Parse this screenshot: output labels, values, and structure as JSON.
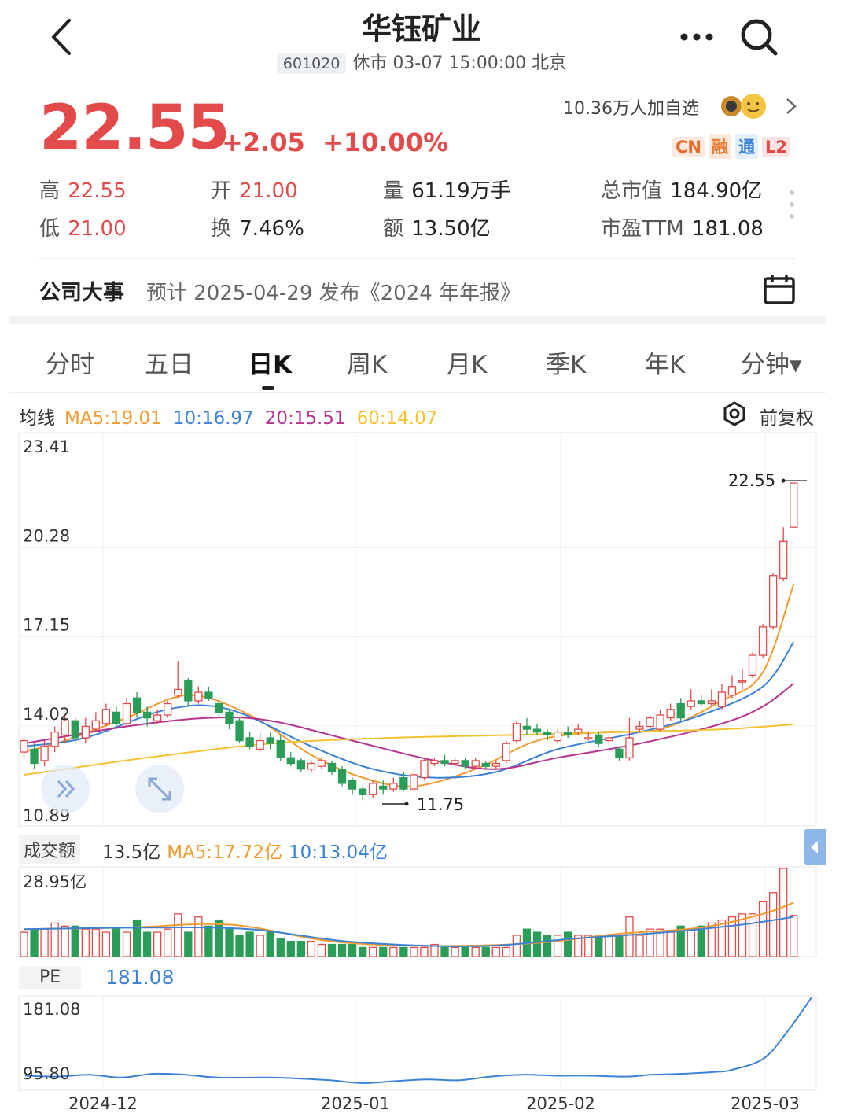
{
  "header": {
    "title": "华钰矿业",
    "code": "601020",
    "status": "休市 03-07 15:00:00 北京",
    "more_icon": "more-dots-icon",
    "search_icon": "search-icon",
    "back_icon": "back-arrow-icon"
  },
  "quote": {
    "price": "22.55",
    "change": "+2.05",
    "change_pct": "+10.00%",
    "followers": "10.36万人加自选",
    "badges": [
      "CN",
      "融",
      "通",
      "L2"
    ],
    "stats": [
      {
        "label": "高",
        "value": "22.55",
        "value_color": "#e34a4a"
      },
      {
        "label": "开",
        "value": "21.00",
        "value_color": "#e34a4a"
      },
      {
        "label": "量",
        "value": "61.19万手",
        "value_color": "#222"
      },
      {
        "label": "总市值",
        "value": "184.90亿",
        "value_color": "#222"
      },
      {
        "label": "低",
        "value": "21.00",
        "value_color": "#e34a4a"
      },
      {
        "label": "换",
        "value": "7.46%",
        "value_color": "#222"
      },
      {
        "label": "额",
        "value": "13.50亿",
        "value_color": "#222"
      },
      {
        "label": "市盈TTM",
        "value": "181.08",
        "value_color": "#222"
      }
    ]
  },
  "event": {
    "title": "公司大事",
    "text": "预计 2025-04-29 发布《2024 年年报》"
  },
  "tabs": [
    {
      "label": "分时",
      "active": false
    },
    {
      "label": "五日",
      "active": false
    },
    {
      "label": "日K",
      "active": true
    },
    {
      "label": "周K",
      "active": false
    },
    {
      "label": "月K",
      "active": false
    },
    {
      "label": "季K",
      "active": false
    },
    {
      "label": "年K",
      "active": false
    },
    {
      "label": "分钟▾",
      "active": false
    }
  ],
  "ma_legend": {
    "title": "均线",
    "items": [
      {
        "text": "MA5:19.01",
        "color": "#f29b2e"
      },
      {
        "text": "10:16.97",
        "color": "#3b82d6"
      },
      {
        "text": "20:15.51",
        "color": "#b8338f"
      },
      {
        "text": "60:14.07",
        "color": "#f2c230"
      }
    ],
    "adjust": "前复权"
  },
  "volume_legend": {
    "title": "成交额",
    "items": [
      {
        "text": "13.5亿",
        "color": "#333"
      },
      {
        "text": "MA5:17.72亿",
        "color": "#f29b2e"
      },
      {
        "text": "10:13.04亿",
        "color": "#3b82d6"
      }
    ]
  },
  "pe_legend": {
    "title": "PE",
    "value": "181.08",
    "value_color": "#3b82d6"
  },
  "colors": {
    "up": "#e34a4a",
    "down": "#2a9d59"
  },
  "chart_data": [
    {
      "type": "candlestick",
      "y_ticks": [
        "23.41",
        "20.28",
        "17.15",
        "14.02",
        "10.89"
      ],
      "ylim": [
        10.89,
        23.41
      ],
      "x_ticks": [
        "2024-12",
        "2025-01",
        "2025-02",
        "2025-03"
      ],
      "annotations": [
        {
          "text": "22.55",
          "kind": "max"
        },
        {
          "text": "11.75",
          "kind": "min"
        }
      ],
      "candles": [
        {
          "o": 13.1,
          "c": 13.5,
          "h": 13.7,
          "l": 12.9
        },
        {
          "o": 13.2,
          "c": 12.7,
          "h": 13.4,
          "l": 12.5
        },
        {
          "o": 12.8,
          "c": 13.3,
          "h": 13.5,
          "l": 12.6
        },
        {
          "o": 13.3,
          "c": 13.8,
          "h": 14.0,
          "l": 13.1
        },
        {
          "o": 13.7,
          "c": 14.2,
          "h": 14.4,
          "l": 13.4
        },
        {
          "o": 14.2,
          "c": 13.6,
          "h": 14.3,
          "l": 13.4
        },
        {
          "o": 13.6,
          "c": 14.0,
          "h": 14.3,
          "l": 13.4
        },
        {
          "o": 13.9,
          "c": 14.2,
          "h": 14.5,
          "l": 13.8
        },
        {
          "o": 14.1,
          "c": 14.6,
          "h": 14.8,
          "l": 14.0
        },
        {
          "o": 14.5,
          "c": 14.1,
          "h": 14.7,
          "l": 13.9
        },
        {
          "o": 14.1,
          "c": 14.8,
          "h": 15.0,
          "l": 14.0
        },
        {
          "o": 15.0,
          "c": 14.5,
          "h": 15.2,
          "l": 14.3
        },
        {
          "o": 14.5,
          "c": 14.3,
          "h": 14.7,
          "l": 14.0
        },
        {
          "o": 14.2,
          "c": 14.4,
          "h": 14.6,
          "l": 14.1
        },
        {
          "o": 14.4,
          "c": 14.8,
          "h": 14.9,
          "l": 14.3
        },
        {
          "o": 15.1,
          "c": 15.3,
          "h": 16.3,
          "l": 15.0
        },
        {
          "o": 15.6,
          "c": 14.9,
          "h": 15.7,
          "l": 14.7
        },
        {
          "o": 14.9,
          "c": 15.2,
          "h": 15.4,
          "l": 14.8
        },
        {
          "o": 15.2,
          "c": 15.0,
          "h": 15.4,
          "l": 14.9
        },
        {
          "o": 14.8,
          "c": 14.5,
          "h": 15.0,
          "l": 14.3
        },
        {
          "o": 14.5,
          "c": 14.1,
          "h": 14.6,
          "l": 13.9
        },
        {
          "o": 14.2,
          "c": 13.5,
          "h": 14.3,
          "l": 13.4
        },
        {
          "o": 13.6,
          "c": 13.3,
          "h": 13.8,
          "l": 13.2
        },
        {
          "o": 13.2,
          "c": 13.5,
          "h": 13.8,
          "l": 13.1
        },
        {
          "o": 13.6,
          "c": 13.4,
          "h": 13.8,
          "l": 13.2
        },
        {
          "o": 13.5,
          "c": 12.9,
          "h": 13.7,
          "l": 12.8
        },
        {
          "o": 12.9,
          "c": 12.7,
          "h": 13.1,
          "l": 12.6
        },
        {
          "o": 12.8,
          "c": 12.5,
          "h": 12.9,
          "l": 12.4
        },
        {
          "o": 12.5,
          "c": 12.7,
          "h": 12.8,
          "l": 12.4
        },
        {
          "o": 12.6,
          "c": 12.8,
          "h": 12.9,
          "l": 12.5
        },
        {
          "o": 12.7,
          "c": 12.4,
          "h": 12.8,
          "l": 12.3
        },
        {
          "o": 12.5,
          "c": 12.0,
          "h": 12.6,
          "l": 11.9
        },
        {
          "o": 12.1,
          "c": 11.8,
          "h": 12.2,
          "l": 11.6
        },
        {
          "o": 11.8,
          "c": 11.6,
          "h": 11.9,
          "l": 11.4
        },
        {
          "o": 11.6,
          "c": 12.0,
          "h": 12.1,
          "l": 11.5
        },
        {
          "o": 11.9,
          "c": 11.8,
          "h": 12.1,
          "l": 11.6
        },
        {
          "o": 11.8,
          "c": 12.0,
          "h": 12.2,
          "l": 11.7
        },
        {
          "o": 12.2,
          "c": 11.8,
          "h": 12.4,
          "l": 11.75
        },
        {
          "o": 11.8,
          "c": 12.3,
          "h": 12.4,
          "l": 11.75
        },
        {
          "o": 12.2,
          "c": 12.8,
          "h": 12.9,
          "l": 12.1
        },
        {
          "o": 12.7,
          "c": 12.8,
          "h": 12.9,
          "l": 12.6
        },
        {
          "o": 12.8,
          "c": 12.7,
          "h": 13.0,
          "l": 12.6
        },
        {
          "o": 12.7,
          "c": 12.8,
          "h": 12.9,
          "l": 12.6
        },
        {
          "o": 12.8,
          "c": 12.6,
          "h": 12.9,
          "l": 12.5
        },
        {
          "o": 12.6,
          "c": 12.8,
          "h": 12.9,
          "l": 12.5
        },
        {
          "o": 12.7,
          "c": 12.6,
          "h": 12.8,
          "l": 12.5
        },
        {
          "o": 12.6,
          "c": 12.7,
          "h": 12.8,
          "l": 12.5
        },
        {
          "o": 12.8,
          "c": 13.4,
          "h": 13.5,
          "l": 12.7
        },
        {
          "o": 13.5,
          "c": 14.1,
          "h": 14.2,
          "l": 13.4
        },
        {
          "o": 14.0,
          "c": 13.9,
          "h": 14.3,
          "l": 13.7
        },
        {
          "o": 13.9,
          "c": 13.8,
          "h": 14.1,
          "l": 13.7
        },
        {
          "o": 13.8,
          "c": 13.7,
          "h": 13.9,
          "l": 13.5
        },
        {
          "o": 13.5,
          "c": 13.8,
          "h": 13.9,
          "l": 13.4
        },
        {
          "o": 13.8,
          "c": 13.7,
          "h": 14.0,
          "l": 13.6
        },
        {
          "o": 13.8,
          "c": 13.9,
          "h": 14.1,
          "l": 13.7
        },
        {
          "o": 13.6,
          "c": 13.6,
          "h": 13.8,
          "l": 13.5
        },
        {
          "o": 13.7,
          "c": 13.4,
          "h": 13.8,
          "l": 13.3
        },
        {
          "o": 13.5,
          "c": 13.6,
          "h": 13.7,
          "l": 13.4
        },
        {
          "o": 13.2,
          "c": 12.9,
          "h": 13.3,
          "l": 12.8
        },
        {
          "o": 12.9,
          "c": 13.6,
          "h": 14.3,
          "l": 12.8
        },
        {
          "o": 13.9,
          "c": 14.0,
          "h": 14.2,
          "l": 13.8
        },
        {
          "o": 14.0,
          "c": 14.3,
          "h": 14.4,
          "l": 13.9
        },
        {
          "o": 13.9,
          "c": 14.4,
          "h": 14.6,
          "l": 13.8
        },
        {
          "o": 14.3,
          "c": 14.6,
          "h": 14.8,
          "l": 14.2
        },
        {
          "o": 14.8,
          "c": 14.3,
          "h": 15.0,
          "l": 14.2
        },
        {
          "o": 14.7,
          "c": 14.9,
          "h": 15.3,
          "l": 14.6
        },
        {
          "o": 14.9,
          "c": 14.8,
          "h": 15.1,
          "l": 14.7
        },
        {
          "o": 14.8,
          "c": 14.9,
          "h": 15.3,
          "l": 14.7
        },
        {
          "o": 14.7,
          "c": 15.2,
          "h": 15.5,
          "l": 14.6
        },
        {
          "o": 15.1,
          "c": 15.4,
          "h": 15.8,
          "l": 15.0
        },
        {
          "o": 15.6,
          "c": 15.6,
          "h": 16.0,
          "l": 15.3
        },
        {
          "o": 15.8,
          "c": 16.5,
          "h": 16.6,
          "l": 15.7
        },
        {
          "o": 16.5,
          "c": 17.5,
          "h": 17.6,
          "l": 16.4
        },
        {
          "o": 17.5,
          "c": 19.3,
          "h": 19.4,
          "l": 17.4
        },
        {
          "o": 19.2,
          "c": 20.5,
          "h": 21.0,
          "l": 19.1
        },
        {
          "o": 21.0,
          "c": 22.55,
          "h": 22.55,
          "l": 21.0
        }
      ],
      "ma_series": [
        {
          "name": "MA5",
          "color": "#f29b2e",
          "anchors": [
            [
              0,
              13.1
            ],
            [
              4,
              13.5
            ],
            [
              10,
              14.3
            ],
            [
              16,
              15.1
            ],
            [
              22,
              14.4
            ],
            [
              28,
              13.0
            ],
            [
              33,
              12.2
            ],
            [
              38,
              11.9
            ],
            [
              44,
              12.5
            ],
            [
              50,
              13.5
            ],
            [
              56,
              13.8
            ],
            [
              62,
              13.9
            ],
            [
              68,
              14.9
            ],
            [
              72,
              15.9
            ],
            [
              75,
              19.01
            ]
          ]
        },
        {
          "name": "10",
          "color": "#3b82d6",
          "anchors": [
            [
              0,
              13.3
            ],
            [
              6,
              13.6
            ],
            [
              14,
              14.6
            ],
            [
              20,
              14.6
            ],
            [
              28,
              13.3
            ],
            [
              34,
              12.5
            ],
            [
              40,
              12.2
            ],
            [
              46,
              12.4
            ],
            [
              52,
              13.2
            ],
            [
              60,
              13.8
            ],
            [
              66,
              14.4
            ],
            [
              72,
              15.4
            ],
            [
              75,
              16.97
            ]
          ]
        },
        {
          "name": "20",
          "color": "#b8338f",
          "anchors": [
            [
              0,
              13.4
            ],
            [
              10,
              14.0
            ],
            [
              18,
              14.3
            ],
            [
              24,
              14.2
            ],
            [
              32,
              13.5
            ],
            [
              40,
              12.8
            ],
            [
              46,
              12.5
            ],
            [
              52,
              12.9
            ],
            [
              60,
              13.4
            ],
            [
              68,
              14.1
            ],
            [
              72,
              14.7
            ],
            [
              75,
              15.51
            ]
          ]
        },
        {
          "name": "60",
          "color": "#f2c230",
          "anchors": [
            [
              0,
              12.3
            ],
            [
              12,
              12.9
            ],
            [
              24,
              13.4
            ],
            [
              36,
              13.6
            ],
            [
              48,
              13.7
            ],
            [
              58,
              13.8
            ],
            [
              68,
              13.9
            ],
            [
              75,
              14.07
            ]
          ]
        }
      ]
    },
    {
      "type": "bar",
      "name": "成交额",
      "y_ticks": [
        "28.95亿"
      ],
      "ylim": [
        0,
        28.95
      ],
      "values": [
        8,
        9,
        9,
        11,
        10,
        10,
        9,
        9,
        8,
        9,
        8,
        12,
        8,
        8,
        9,
        14,
        8,
        13,
        10,
        12,
        9,
        7,
        8,
        7,
        8,
        6,
        5,
        5,
        5,
        4,
        4,
        4,
        4,
        3,
        3,
        3,
        3,
        3,
        3,
        3,
        4,
        3,
        3,
        3,
        3,
        3,
        3,
        3,
        7,
        9,
        8,
        7,
        7,
        8,
        7,
        7,
        7,
        7,
        7,
        13,
        7,
        9,
        9,
        8,
        10,
        9,
        10,
        11,
        12,
        13,
        14,
        14,
        18,
        21,
        28.95,
        13.5
      ],
      "ma_series": [
        {
          "name": "MA5",
          "color": "#f29b2e",
          "anchors": [
            [
              0,
              9
            ],
            [
              10,
              9.5
            ],
            [
              20,
              10.5
            ],
            [
              30,
              5
            ],
            [
              40,
              3.5
            ],
            [
              50,
              4.5
            ],
            [
              58,
              7.5
            ],
            [
              66,
              9.5
            ],
            [
              72,
              14
            ],
            [
              75,
              17.72
            ]
          ]
        },
        {
          "name": "10",
          "color": "#3b82d6",
          "anchors": [
            [
              0,
              9
            ],
            [
              12,
              9.5
            ],
            [
              22,
              9
            ],
            [
              32,
              4.8
            ],
            [
              44,
              3.4
            ],
            [
              54,
              6
            ],
            [
              62,
              7.8
            ],
            [
              70,
              10.5
            ],
            [
              75,
              13.04
            ]
          ]
        }
      ]
    },
    {
      "type": "line",
      "name": "PE",
      "y_ticks": [
        "181.08",
        "95.80"
      ],
      "ylim": [
        95.8,
        181.08
      ],
      "anchors": [
        [
          0,
          98
        ],
        [
          4,
          97
        ],
        [
          8,
          99
        ],
        [
          12,
          96
        ],
        [
          16,
          100
        ],
        [
          20,
          99
        ],
        [
          24,
          96
        ],
        [
          30,
          96
        ],
        [
          34,
          95
        ],
        [
          38,
          93
        ],
        [
          42,
          90
        ],
        [
          46,
          92
        ],
        [
          50,
          94
        ],
        [
          54,
          93
        ],
        [
          58,
          97
        ],
        [
          62,
          99
        ],
        [
          66,
          98
        ],
        [
          70,
          98
        ],
        [
          75,
          97
        ],
        [
          78,
          99
        ],
        [
          82,
          100
        ],
        [
          86,
          102
        ],
        [
          88,
          104
        ],
        [
          92,
          116
        ],
        [
          95,
          145
        ],
        [
          98,
          181.08
        ]
      ]
    }
  ]
}
